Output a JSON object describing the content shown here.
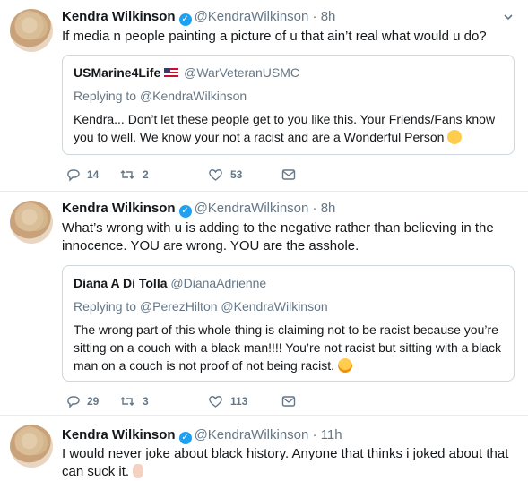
{
  "tweets": [
    {
      "name": "Kendra Wilkinson",
      "handle": "@KendraWilkinson",
      "dot": "·",
      "time": "8h",
      "text": "If media n people painting a picture of u that ain’t real what would u do?",
      "quote": {
        "name": "USMarine4Life",
        "handle": "@WarVeteranUSMC",
        "reply_prefix": "Replying to",
        "reply_to": "@KendraWilkinson",
        "text": "Kendra... Don’t let these people get to you like this. Your Friends/Fans know you to well. We know your not a racist and are a Wonderful Person"
      },
      "replies": "14",
      "retweets": "2",
      "likes": "53"
    },
    {
      "name": "Kendra Wilkinson",
      "handle": "@KendraWilkinson",
      "dot": "·",
      "time": "8h",
      "text": "What’s wrong with u is adding to the negative rather than believing in the innocence.  YOU are wrong. YOU are the asshole.",
      "quote": {
        "name": "Diana A Di Tolla",
        "handle": "@DianaAdrienne",
        "reply_prefix": "Replying to",
        "reply_to": "@PerezHilton @KendraWilkinson",
        "text": "The wrong part of this whole thing is claiming not to be racist because you’re sitting on a couch with a black man!!!!  You’re not racist but sitting with a black man on a couch is not proof of not being racist."
      },
      "replies": "29",
      "retweets": "3",
      "likes": "113"
    },
    {
      "name": "Kendra Wilkinson",
      "handle": "@KendraWilkinson",
      "dot": "·",
      "time": "11h",
      "text": "I would never joke about black history.  Anyone that thinks i joked about that can suck it."
    }
  ],
  "colors": {
    "accent": "#1da1f2",
    "muted": "#657786",
    "border": "#ccd6dd"
  },
  "icons": [
    "reply-icon",
    "retweet-icon",
    "like-icon",
    "dm-icon",
    "verified-icon",
    "chevron-down-icon"
  ]
}
